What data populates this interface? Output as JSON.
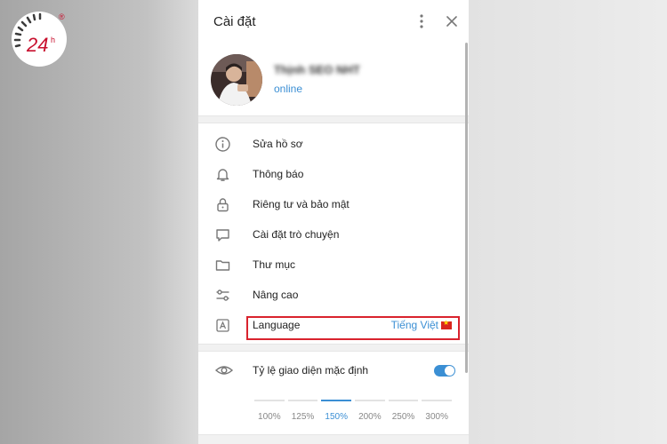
{
  "logo": {
    "text": "24h",
    "mark": "®"
  },
  "panel": {
    "title": "Cài đặt",
    "profile": {
      "name": "Thịnh SEO NHT",
      "status": "online"
    },
    "menu": [
      {
        "icon": "info-icon",
        "label": "Sửa hồ sơ"
      },
      {
        "icon": "bell-icon",
        "label": "Thông báo"
      },
      {
        "icon": "lock-icon",
        "label": "Riêng tư và bảo mật"
      },
      {
        "icon": "chat-bubble-icon",
        "label": "Cài đặt trò chuyện"
      },
      {
        "icon": "folder-icon",
        "label": "Thư mục"
      },
      {
        "icon": "sliders-icon",
        "label": "Nâng cao"
      },
      {
        "icon": "language-icon",
        "label": "Language",
        "value": "Tiếng Việt"
      }
    ],
    "scale": {
      "label": "Tỷ lệ giao diện mặc định",
      "enabled": true,
      "options": [
        "100%",
        "125%",
        "150%",
        "200%",
        "250%",
        "300%"
      ],
      "selected": "150%"
    }
  },
  "colors": {
    "accent": "#3b8fd4",
    "highlight": "#d9232e",
    "logo_red": "#c8102e"
  }
}
